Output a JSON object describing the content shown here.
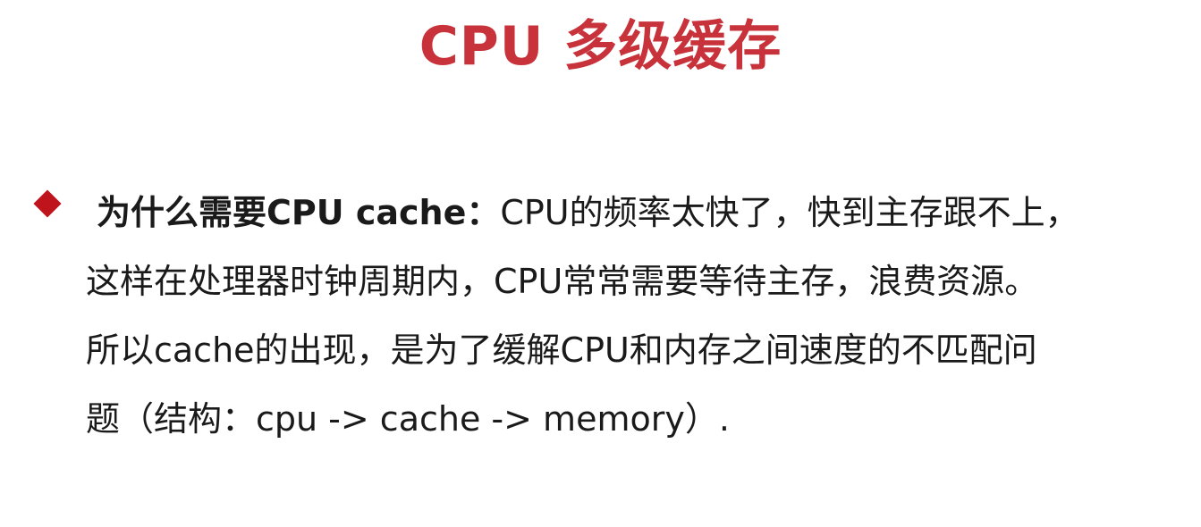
{
  "slide": {
    "title": "CPU 多级缓存",
    "bullet": {
      "lead": "为什么需要CPU cache：",
      "lines": [
        "CPU的频率太快了，快到主存跟不上，",
        "这样在处理器时钟周期内，CPU常常需要等待主存，浪费资源。",
        "所以cache的出现，是为了缓解CPU和内存之间速度的不匹配问",
        "题（结构：cpu -> cache -> memory）."
      ]
    }
  },
  "colors": {
    "title": "#c8323a",
    "bullet_marker": "#c0141c",
    "text": "#1a1a1a"
  },
  "icons": {
    "bullet_marker": "diamond-bullet-icon"
  }
}
